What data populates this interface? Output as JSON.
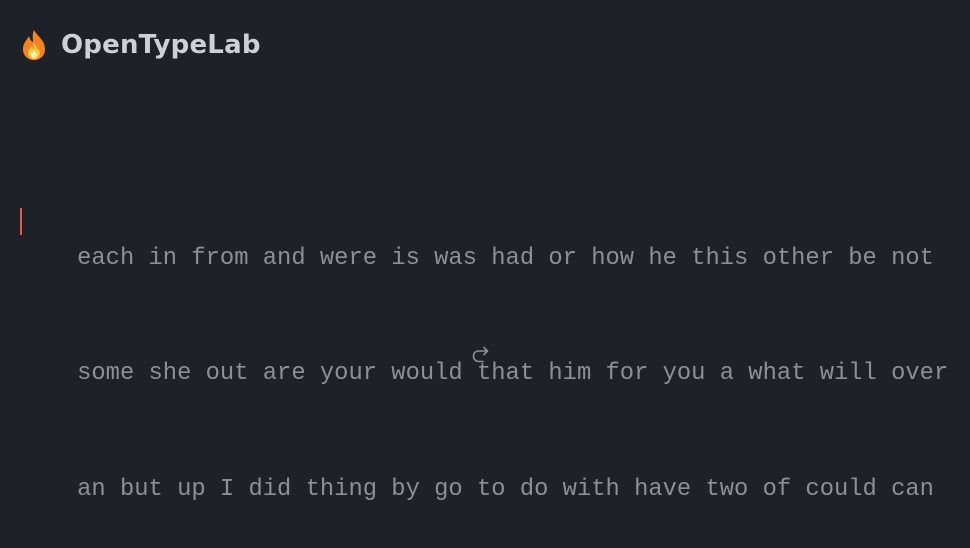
{
  "app": {
    "brand": "OpenTypeLab",
    "logo_icon": "flame-icon"
  },
  "typing": {
    "lines": [
      "each in from and were is was had or how he this other be not",
      "some she out are your would that him for you a what will over",
      "an but up I did thing by go to do with have two of could can"
    ],
    "caret_color": "#e05a45",
    "text_color": "#8c8f96"
  },
  "controls": {
    "restart_icon": "redo-arrow-icon"
  },
  "colors": {
    "background": "#1f2129",
    "brand_text": "#cdd0d6"
  }
}
